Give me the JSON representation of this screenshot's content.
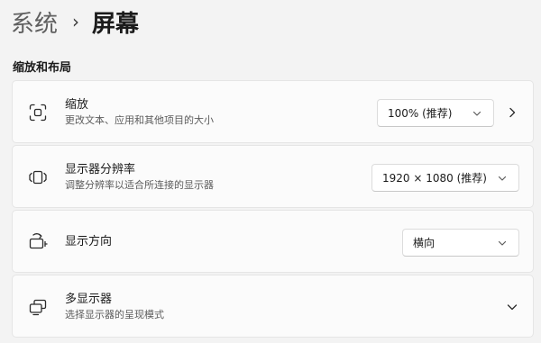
{
  "breadcrumb": {
    "parent": "系统",
    "separator": "›",
    "current": "屏幕"
  },
  "section": {
    "heading": "缩放和布局"
  },
  "cards": {
    "scale": {
      "icon": "scale-icon",
      "title": "缩放",
      "subtitle": "更改文本、应用和其他项目的大小",
      "dropdown_value": "100% (推荐)",
      "row_chevron": "chevron-right-icon"
    },
    "resolution": {
      "icon": "resolution-icon",
      "title": "显示器分辨率",
      "subtitle": "调整分辨率以适合所连接的显示器",
      "dropdown_value": "1920 × 1080 (推荐)"
    },
    "orientation": {
      "icon": "orientation-icon",
      "title": "显示方向",
      "dropdown_value": "横向"
    },
    "multi_display": {
      "icon": "multiple-displays-icon",
      "title": "多显示器",
      "subtitle": "选择显示器的呈现模式",
      "row_chevron": "chevron-down-icon"
    }
  },
  "colors": {
    "page_background": "#f3f3f3",
    "card_background": "#fbfbfb",
    "card_border": "#e5e5e5",
    "text_primary": "#1b1b1b",
    "text_secondary": "#5c5c5c"
  }
}
